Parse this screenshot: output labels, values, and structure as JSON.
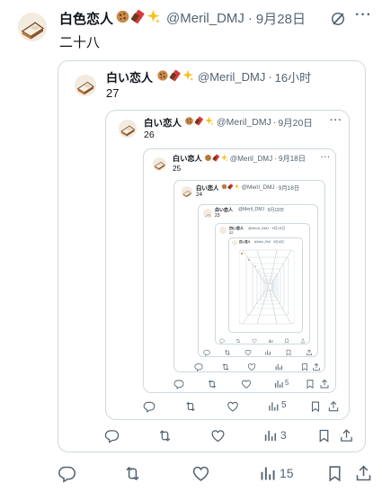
{
  "outer": {
    "name": "白色恋人",
    "handle": "@Meril_DMJ",
    "date": "9月28日",
    "text": "二十八",
    "actions": {
      "views": "15"
    }
  },
  "q1": {
    "name": "白い恋人",
    "handle": "@Meril_DMJ",
    "time": "16小时",
    "text": "27",
    "actions": {
      "views": "3"
    }
  },
  "q2": {
    "name": "白い恋人",
    "handle": "@Meril_DMJ",
    "date": "9月20日",
    "text": "26",
    "actions": {
      "views": "5"
    }
  },
  "q3": {
    "name": "白い恋人",
    "handle": "@Meril_DMJ",
    "date": "9月18日",
    "text": "25",
    "actions": {
      "views": "5"
    }
  },
  "q4": {
    "name": "白い恋人",
    "handle": "@Meril_DMJ",
    "date": "9月18日",
    "text": "24"
  },
  "q5": {
    "name": "白い恋人",
    "handle": "@Meril_DMJ",
    "date": "9月18日",
    "text": "23"
  },
  "q6": {
    "name": "白い恋人",
    "handle": "@Meril_DMJ",
    "date": "9月18日",
    "text": "22"
  },
  "q7": {
    "name": "白い恋人",
    "handle": "@Meril_DMJ",
    "date": "9月18日"
  },
  "separator": "·"
}
